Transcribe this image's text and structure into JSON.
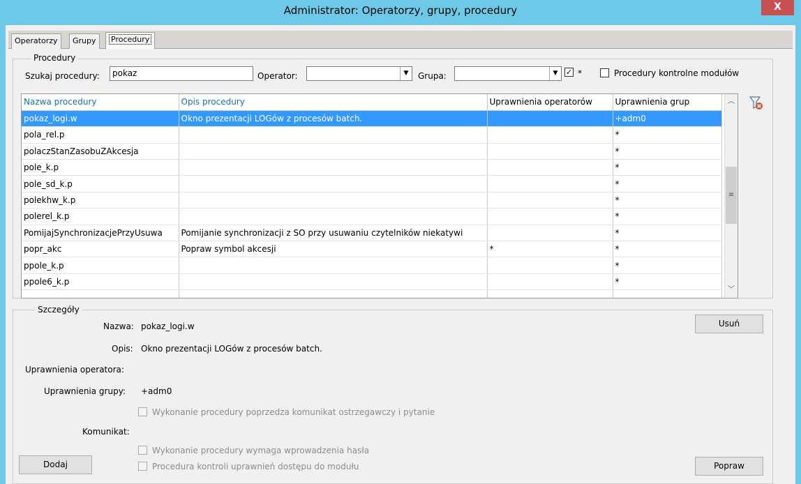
{
  "window": {
    "title": "Administrator: Operatorzy, grupy, procedury",
    "close_label": "X"
  },
  "tabs": [
    "Operatorzy",
    "Grupy",
    "Procedury"
  ],
  "procedury": {
    "legend": "Procedury",
    "search_label": "Szukaj procedury:",
    "search_value": "pokaz",
    "operator_label": "Operator:",
    "operator_value": "",
    "grupa_label": "Grupa:",
    "grupa_value": "",
    "star_checked": true,
    "star_label": "*",
    "kontrolne_checked": false,
    "kontrolne_label": "Procedury kontrolne modułów"
  },
  "grid": {
    "columns": [
      "Nazwa procedury",
      "Opis procedury",
      "Uprawnienia operatorów",
      "Uprawnienia grup"
    ],
    "rows": [
      [
        "pokaz_logi.w",
        "Okno prezentacji LOGów z procesów batch.",
        "",
        "+adm0"
      ],
      [
        "pola_rel.p",
        "",
        "",
        "*"
      ],
      [
        "polaczStanZasobuZAkcesja",
        "",
        "",
        "*"
      ],
      [
        "pole_k.p",
        "",
        "",
        "*"
      ],
      [
        "pole_sd_k.p",
        "",
        "",
        "*"
      ],
      [
        "polekhw_k.p",
        "",
        "",
        "*"
      ],
      [
        "polerel_k.p",
        "",
        "",
        "*"
      ],
      [
        "PomijajSynchronizacjePrzyUsuwa",
        "Pomijanie synchronizacji z SO przy usuwaniu czytelników niekatywi",
        "",
        "*"
      ],
      [
        "popr_akc",
        "Popraw symbol akcesji",
        "*",
        "*"
      ],
      [
        "ppole_k.p",
        "",
        "",
        "*"
      ],
      [
        "ppole6_k.p",
        "",
        "",
        "*"
      ]
    ],
    "selected_row": 0,
    "scroll_fraction": 0.42
  },
  "details": {
    "legend": "Szczegóły",
    "nazwa_label": "Nazwa:",
    "nazwa_value": "pokaz_logi.w",
    "opis_label": "Opis:",
    "opis_value": "Okno prezentacji LOGów z procesów batch.",
    "upr_op_label": "Uprawnienia operatora:",
    "upr_op_value": "",
    "upr_gr_label": "Uprawnienia grupy:",
    "upr_gr_value": "+adm0",
    "chk_ostrzezenie": "Wykonanie procedury poprzedza komunikat ostrzegawczy i pytanie",
    "komunikat_label": "Komunikat:",
    "chk_haslo": "Wykonanie procedury wymaga wprowadzenia hasła",
    "chk_kontrola": "Procedura kontroli uprawnień dostępu do modułu"
  },
  "buttons": {
    "usun": "Usuń",
    "dodaj": "Dodaj",
    "popraw": "Popraw"
  },
  "colors": {
    "titlebar": "#6ec9e8",
    "selection": "#3399ff",
    "header_text": "#1a6fb5",
    "close": "#c75050"
  }
}
